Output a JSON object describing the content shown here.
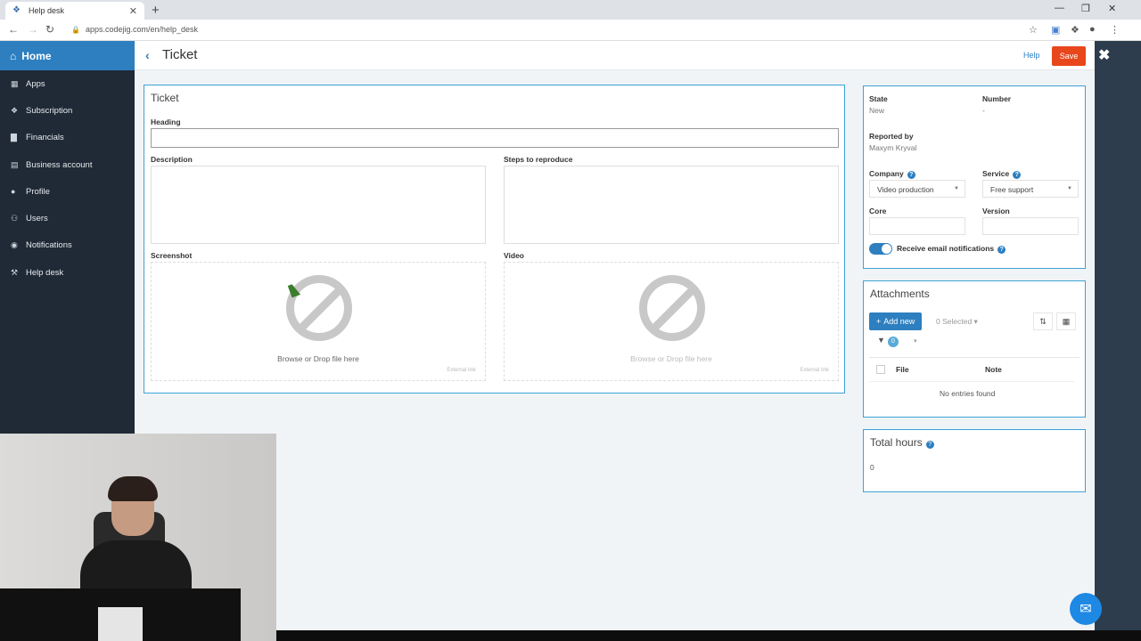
{
  "browser": {
    "tab_title": "Help desk",
    "url": "apps.codejig.com/en/help_desk"
  },
  "sidebar": {
    "home_label": "Home",
    "items": [
      {
        "label": "Apps",
        "icon": "grid-icon"
      },
      {
        "label": "Subscription",
        "icon": "cubes-icon"
      },
      {
        "label": "Financials",
        "icon": "bar-chart-icon"
      },
      {
        "label": "Business account",
        "icon": "building-icon"
      },
      {
        "label": "Profile",
        "icon": "user-icon"
      },
      {
        "label": "Users",
        "icon": "users-icon"
      },
      {
        "label": "Notifications",
        "icon": "broadcast-icon"
      },
      {
        "label": "Help desk",
        "icon": "wrench-icon"
      }
    ]
  },
  "header": {
    "title": "Ticket",
    "help_label": "Help",
    "save_label": "Save"
  },
  "ticket": {
    "panel_title": "Ticket",
    "heading_label": "Heading",
    "heading_value": "",
    "description_label": "Description",
    "steps_label": "Steps to reproduce",
    "screenshot_label": "Screenshot",
    "video_label": "Video",
    "drop_text": "Browse or Drop file here",
    "external_link": "External link"
  },
  "details": {
    "state_label": "State",
    "state_value": "New",
    "number_label": "Number",
    "number_value": "-",
    "reported_by_label": "Reported by",
    "reported_by_value": "Maxym Kryval",
    "company_label": "Company",
    "company_value": "Video production",
    "service_label": "Service",
    "service_value": "Free support",
    "core_label": "Core",
    "version_label": "Version",
    "email_notifications_label": "Receive email notifications",
    "email_notifications_on": true
  },
  "attachments": {
    "title": "Attachments",
    "add_new_label": "Add new",
    "selected_label": "0 Selected",
    "filter_count": "0",
    "columns": [
      "File",
      "Note"
    ],
    "empty_text": "No entries found"
  },
  "total_hours": {
    "title": "Total hours",
    "value": "0"
  },
  "colors": {
    "accent": "#2d7fc0",
    "save": "#e8471c",
    "sidebar_bg": "#1f2a36"
  }
}
